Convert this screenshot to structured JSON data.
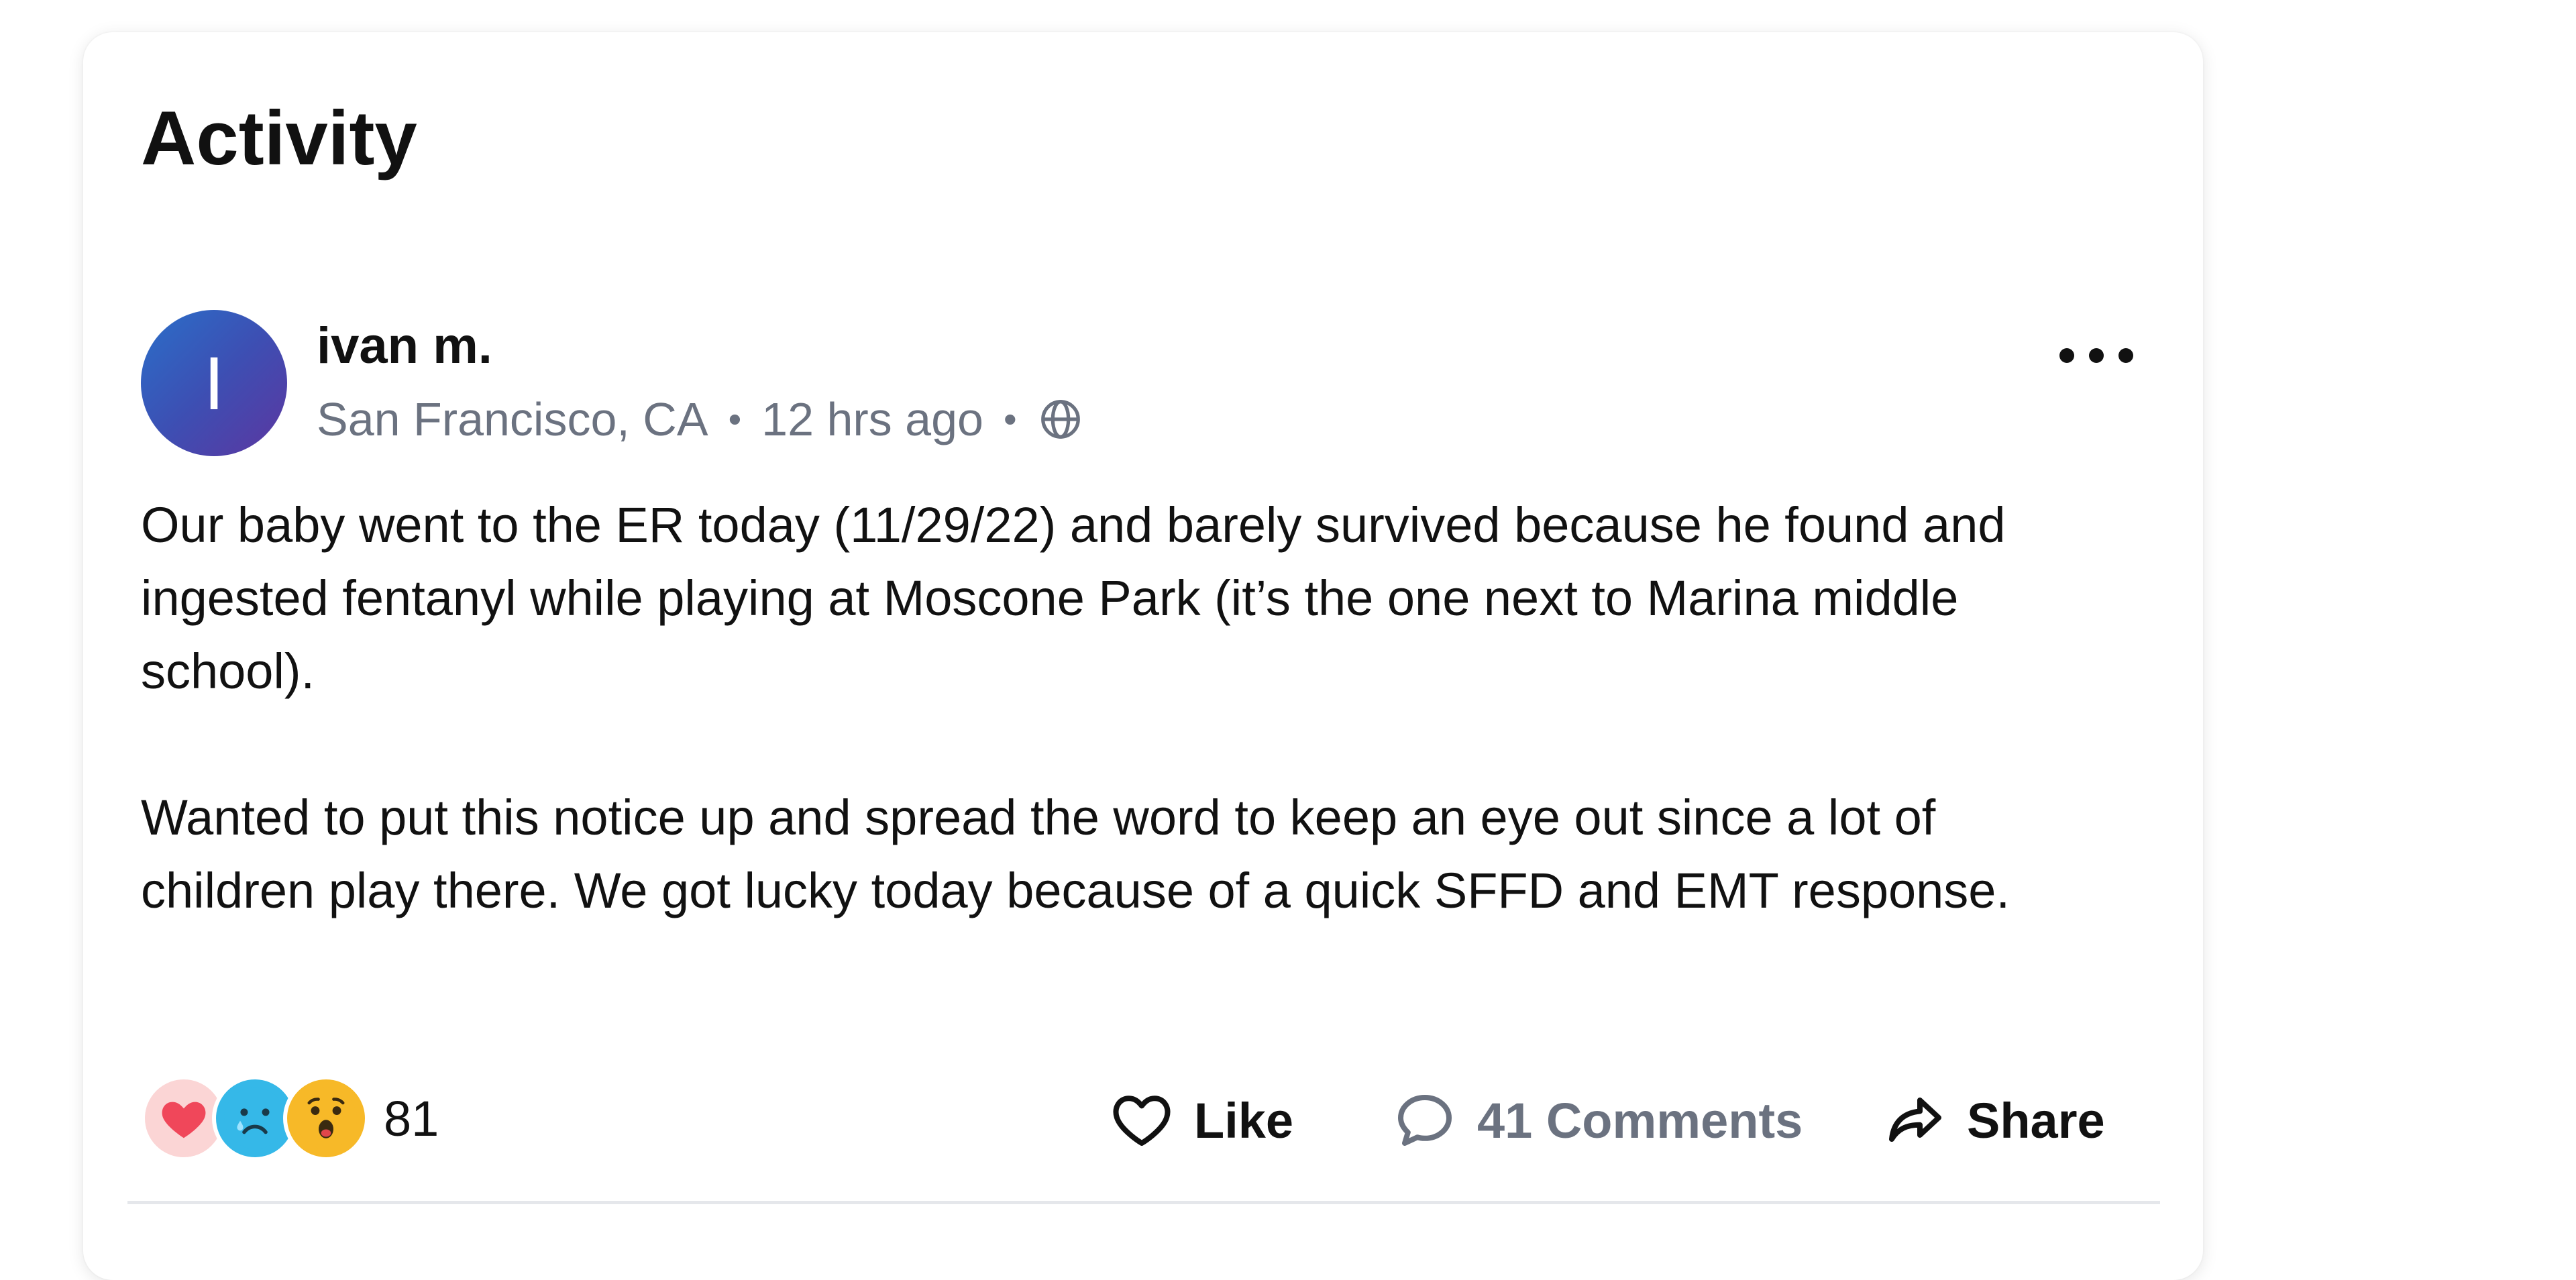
{
  "section": {
    "title": "Activity"
  },
  "post": {
    "author": {
      "initial": "I",
      "name": "ivan m."
    },
    "location": "San Francisco, CA",
    "time": "12 hrs ago",
    "separator": "•",
    "visibility_icon": "globe-icon",
    "body": [
      "Our baby went to the ER today (11/29/22) and barely survived because he found and ingested fentanyl while playing at Moscone Park (it’s the one next to Marina middle school).",
      "Wanted to put this notice up and spread the word to keep an eye out since a lot of children play there. We got lucky today because of a quick SFFD and EMT response."
    ],
    "reactions": {
      "icons": [
        "heart-reaction-icon",
        "sad-tear-reaction-icon",
        "wow-reaction-icon"
      ],
      "count": "81"
    },
    "actions": {
      "like_label": "Like",
      "comments_label": "41 Comments",
      "share_label": "Share"
    }
  },
  "colors": {
    "text": "#111111",
    "muted": "#6b7280",
    "avatar_gradient_start": "#2a6fc9",
    "avatar_gradient_end": "#5c36a0",
    "heart": "#f0475a",
    "sad": "#35b8e8",
    "wow": "#f7b928"
  }
}
